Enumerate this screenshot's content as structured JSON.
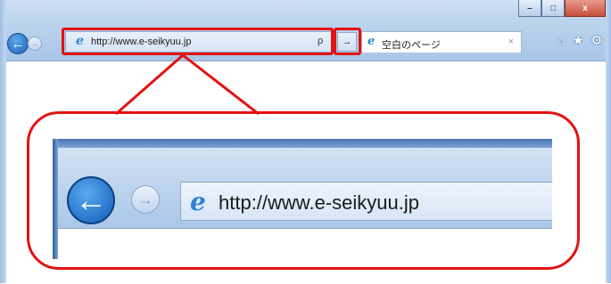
{
  "browser": {
    "address_url": "http://www.e-seikyuu.jp",
    "tab_label": "空白のページ",
    "tab_close": "×",
    "go_glyph": "→",
    "search_glyph": "ρ",
    "window_buttons": {
      "minimize": "–",
      "restore": "□",
      "close": "x"
    },
    "toolbar": {
      "home": "⌂",
      "favorites": "★",
      "tools": "⚙"
    }
  },
  "zoom": {
    "address_url": "http://www.e-seikyuu.jp"
  },
  "colors": {
    "highlight": "#e31212",
    "chrome_light": "#cfe0f3",
    "chrome_dark": "#a9c6e8",
    "ie_blue": "#2c83d6"
  },
  "icons": [
    "back-icon",
    "forward-icon",
    "ie-page-icon",
    "search-icon",
    "go-arrow-icon",
    "home-icon",
    "star-icon",
    "gear-icon"
  ]
}
